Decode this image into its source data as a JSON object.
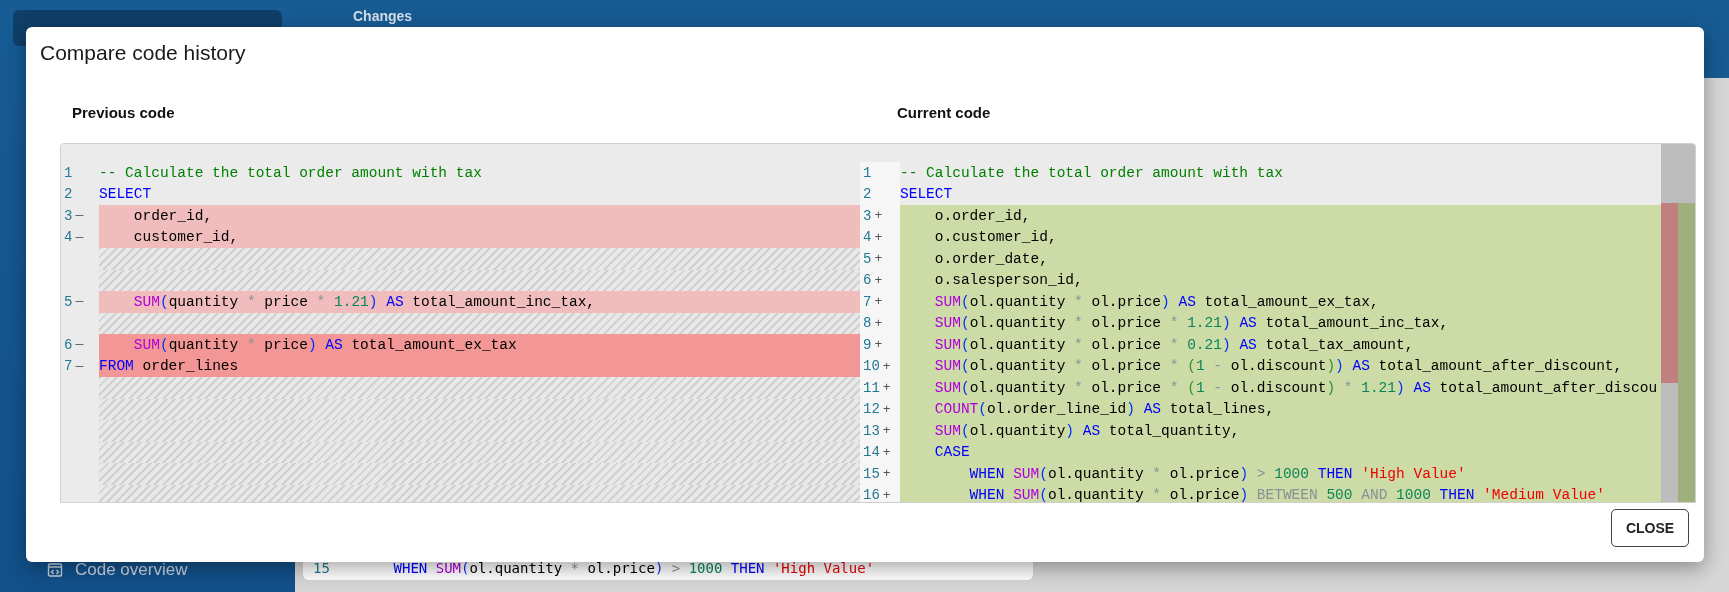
{
  "app": {
    "header": "Changes",
    "sidebar_item": "Code overview",
    "background_code": {
      "number": "15",
      "tokens": [
        {
          "t": "    WHEN ",
          "kind": "keyword"
        },
        {
          "t": "SUM",
          "kind": "function"
        },
        {
          "t": "(",
          "kind": "paren"
        },
        {
          "t": "ol.quantity ",
          "kind": "plain"
        },
        {
          "t": "*",
          "kind": "operator"
        },
        {
          "t": " ol.price",
          "kind": "plain"
        },
        {
          "t": ")",
          "kind": "paren"
        },
        {
          "t": " > ",
          "kind": "operator"
        },
        {
          "t": "1000",
          "kind": "number"
        },
        {
          "t": " THEN ",
          "kind": "keyword"
        },
        {
          "t": "'High Value'",
          "kind": "string"
        }
      ]
    }
  },
  "dialog": {
    "title": "Compare code history",
    "close_button": "CLOSE",
    "panes": [
      {
        "title": "Previous code",
        "lines": [
          {
            "kind": "context",
            "number": "1",
            "tokens": [
              {
                "t": "-- Calculate the total order amount with tax",
                "kind": "comment"
              }
            ]
          },
          {
            "kind": "context",
            "number": "2",
            "tokens": [
              {
                "t": "SELECT",
                "kind": "keyword"
              }
            ]
          },
          {
            "kind": "removed",
            "strong": false,
            "number": "3",
            "marker": "—",
            "tokens": [
              {
                "t": "    order_id,",
                "kind": "plain"
              }
            ]
          },
          {
            "kind": "removed",
            "strong": false,
            "number": "4",
            "marker": "—",
            "tokens": [
              {
                "t": "    customer_id,",
                "kind": "plain"
              }
            ]
          },
          {
            "kind": "filler"
          },
          {
            "kind": "filler"
          },
          {
            "kind": "removed",
            "strong": false,
            "number": "5",
            "marker": "—",
            "tokens": [
              {
                "t": "    SUM",
                "kind": "function"
              },
              {
                "t": "(",
                "kind": "paren"
              },
              {
                "t": "quantity ",
                "kind": "plain"
              },
              {
                "t": "*",
                "kind": "operator"
              },
              {
                "t": " price ",
                "kind": "plain"
              },
              {
                "t": "*",
                "kind": "operator"
              },
              {
                "t": " 1.21",
                "kind": "number"
              },
              {
                "t": ")",
                "kind": "paren"
              },
              {
                "t": " AS",
                "kind": "keyword"
              },
              {
                "t": " total_amount_inc_tax,",
                "kind": "plain"
              }
            ]
          },
          {
            "kind": "filler"
          },
          {
            "kind": "removed",
            "strong": true,
            "number": "6",
            "marker": "—",
            "tokens": [
              {
                "t": "    SUM",
                "kind": "function"
              },
              {
                "t": "(",
                "kind": "paren"
              },
              {
                "t": "quantity ",
                "kind": "plain"
              },
              {
                "t": "*",
                "kind": "operator"
              },
              {
                "t": " price",
                "kind": "plain"
              },
              {
                "t": ")",
                "kind": "paren"
              },
              {
                "t": " AS",
                "kind": "keyword"
              },
              {
                "t": " total_amount_ex_tax",
                "kind": "plain"
              }
            ]
          },
          {
            "kind": "removed",
            "strong": true,
            "number": "7",
            "marker": "—",
            "tokens": [
              {
                "t": "FROM",
                "kind": "keyword"
              },
              {
                "t": " order_lines",
                "kind": "plain"
              }
            ]
          },
          {
            "kind": "filler"
          },
          {
            "kind": "filler"
          },
          {
            "kind": "filler"
          },
          {
            "kind": "filler"
          },
          {
            "kind": "filler"
          },
          {
            "kind": "filler"
          }
        ]
      },
      {
        "title": "Current code",
        "lines": [
          {
            "kind": "context",
            "number": "1",
            "tokens": [
              {
                "t": "-- Calculate the total order amount with tax",
                "kind": "comment"
              }
            ]
          },
          {
            "kind": "context",
            "number": "2",
            "tokens": [
              {
                "t": "SELECT",
                "kind": "keyword"
              }
            ]
          },
          {
            "kind": "added",
            "number": "3",
            "marker": "+",
            "tokens": [
              {
                "t": "    o.order_id,",
                "kind": "plain"
              }
            ]
          },
          {
            "kind": "added",
            "number": "4",
            "marker": "+",
            "tokens": [
              {
                "t": "    o.customer_id,",
                "kind": "plain"
              }
            ]
          },
          {
            "kind": "added",
            "number": "5",
            "marker": "+",
            "tokens": [
              {
                "t": "    o.order_date,",
                "kind": "plain"
              }
            ]
          },
          {
            "kind": "added",
            "number": "6",
            "marker": "+",
            "tokens": [
              {
                "t": "    o.salesperson_id,",
                "kind": "plain"
              }
            ]
          },
          {
            "kind": "added",
            "number": "7",
            "marker": "+",
            "tokens": [
              {
                "t": "    SUM",
                "kind": "function"
              },
              {
                "t": "(",
                "kind": "paren"
              },
              {
                "t": "ol.quantity ",
                "kind": "plain"
              },
              {
                "t": "*",
                "kind": "operator"
              },
              {
                "t": " ol.price",
                "kind": "plain"
              },
              {
                "t": ")",
                "kind": "paren"
              },
              {
                "t": " AS",
                "kind": "keyword"
              },
              {
                "t": " total_amount_ex_tax,",
                "kind": "plain"
              }
            ]
          },
          {
            "kind": "added",
            "number": "8",
            "marker": "+",
            "tokens": [
              {
                "t": "    SUM",
                "kind": "function"
              },
              {
                "t": "(",
                "kind": "paren"
              },
              {
                "t": "ol.quantity ",
                "kind": "plain"
              },
              {
                "t": "*",
                "kind": "operator"
              },
              {
                "t": " ol.price ",
                "kind": "plain"
              },
              {
                "t": "*",
                "kind": "operator"
              },
              {
                "t": " 1.21",
                "kind": "number"
              },
              {
                "t": ")",
                "kind": "paren"
              },
              {
                "t": " AS",
                "kind": "keyword"
              },
              {
                "t": " total_amount_inc_tax,",
                "kind": "plain"
              }
            ]
          },
          {
            "kind": "added",
            "number": "9",
            "marker": "+",
            "tokens": [
              {
                "t": "    SUM",
                "kind": "function"
              },
              {
                "t": "(",
                "kind": "paren"
              },
              {
                "t": "ol.quantity ",
                "kind": "plain"
              },
              {
                "t": "*",
                "kind": "operator"
              },
              {
                "t": " ol.price ",
                "kind": "plain"
              },
              {
                "t": "*",
                "kind": "operator"
              },
              {
                "t": " 0.21",
                "kind": "number"
              },
              {
                "t": ")",
                "kind": "paren"
              },
              {
                "t": " AS",
                "kind": "keyword"
              },
              {
                "t": " total_tax_amount,",
                "kind": "plain"
              }
            ]
          },
          {
            "kind": "added",
            "number": "10",
            "marker": "+",
            "tokens": [
              {
                "t": "    SUM",
                "kind": "function"
              },
              {
                "t": "(",
                "kind": "paren"
              },
              {
                "t": "ol.quantity ",
                "kind": "plain"
              },
              {
                "t": "*",
                "kind": "operator"
              },
              {
                "t": " ol.price ",
                "kind": "plain"
              },
              {
                "t": "*",
                "kind": "operator"
              },
              {
                "t": " (",
                "kind": "inner-paren"
              },
              {
                "t": "1 ",
                "kind": "number"
              },
              {
                "t": "-",
                "kind": "operator"
              },
              {
                "t": " ol.discount",
                "kind": "plain"
              },
              {
                "t": ")",
                "kind": "inner-paren"
              },
              {
                "t": ")",
                "kind": "paren"
              },
              {
                "t": " AS",
                "kind": "keyword"
              },
              {
                "t": " total_amount_after_discount,",
                "kind": "plain"
              }
            ]
          },
          {
            "kind": "added",
            "number": "11",
            "marker": "+",
            "tokens": [
              {
                "t": "    SUM",
                "kind": "function"
              },
              {
                "t": "(",
                "kind": "paren"
              },
              {
                "t": "ol.quantity ",
                "kind": "plain"
              },
              {
                "t": "*",
                "kind": "operator"
              },
              {
                "t": " ol.price ",
                "kind": "plain"
              },
              {
                "t": "*",
                "kind": "operator"
              },
              {
                "t": " (",
                "kind": "inner-paren"
              },
              {
                "t": "1 ",
                "kind": "number"
              },
              {
                "t": "-",
                "kind": "operator"
              },
              {
                "t": " ol.discount",
                "kind": "plain"
              },
              {
                "t": ")",
                "kind": "inner-paren"
              },
              {
                "t": " *",
                "kind": "operator"
              },
              {
                "t": " 1.21",
                "kind": "number"
              },
              {
                "t": ")",
                "kind": "paren"
              },
              {
                "t": " AS",
                "kind": "keyword"
              },
              {
                "t": " total_amount_after_discou",
                "kind": "plain"
              }
            ]
          },
          {
            "kind": "added",
            "number": "12",
            "marker": "+",
            "tokens": [
              {
                "t": "    COUNT",
                "kind": "function"
              },
              {
                "t": "(",
                "kind": "paren"
              },
              {
                "t": "ol.order_line_id",
                "kind": "plain"
              },
              {
                "t": ")",
                "kind": "paren"
              },
              {
                "t": " AS",
                "kind": "keyword"
              },
              {
                "t": " total_lines,",
                "kind": "plain"
              }
            ]
          },
          {
            "kind": "added",
            "number": "13",
            "marker": "+",
            "tokens": [
              {
                "t": "    SUM",
                "kind": "function"
              },
              {
                "t": "(",
                "kind": "paren"
              },
              {
                "t": "ol.quantity",
                "kind": "plain"
              },
              {
                "t": ")",
                "kind": "paren"
              },
              {
                "t": " AS",
                "kind": "keyword"
              },
              {
                "t": " total_quantity,",
                "kind": "plain"
              }
            ]
          },
          {
            "kind": "added",
            "number": "14",
            "marker": "+",
            "tokens": [
              {
                "t": "    CASE",
                "kind": "keyword"
              }
            ]
          },
          {
            "kind": "added",
            "number": "15",
            "marker": "+",
            "tokens": [
              {
                "t": "        WHEN ",
                "kind": "keyword"
              },
              {
                "t": "SUM",
                "kind": "function"
              },
              {
                "t": "(",
                "kind": "paren"
              },
              {
                "t": "ol.quantity ",
                "kind": "plain"
              },
              {
                "t": "*",
                "kind": "operator"
              },
              {
                "t": " ol.price",
                "kind": "plain"
              },
              {
                "t": ")",
                "kind": "paren"
              },
              {
                "t": " > ",
                "kind": "operator"
              },
              {
                "t": "1000",
                "kind": "number"
              },
              {
                "t": " THEN ",
                "kind": "keyword"
              },
              {
                "t": "'High Value'",
                "kind": "string"
              }
            ]
          },
          {
            "kind": "added",
            "number": "16",
            "marker": "+",
            "tokens": [
              {
                "t": "        WHEN ",
                "kind": "keyword"
              },
              {
                "t": "SUM",
                "kind": "function"
              },
              {
                "t": "(",
                "kind": "paren"
              },
              {
                "t": "ol.quantity ",
                "kind": "plain"
              },
              {
                "t": "*",
                "kind": "operator"
              },
              {
                "t": " ol.price",
                "kind": "plain"
              },
              {
                "t": ")",
                "kind": "paren"
              },
              {
                "t": " BETWEEN ",
                "kind": "operator"
              },
              {
                "t": "500",
                "kind": "number"
              },
              {
                "t": " AND ",
                "kind": "operator"
              },
              {
                "t": "1000",
                "kind": "number"
              },
              {
                "t": " THEN ",
                "kind": "keyword"
              },
              {
                "t": "'Medium Value'",
                "kind": "string"
              }
            ]
          }
        ]
      }
    ]
  }
}
